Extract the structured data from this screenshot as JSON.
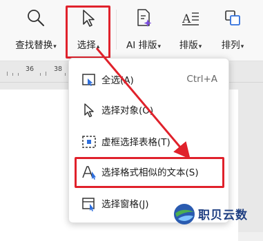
{
  "toolbar": {
    "find_replace_label": "查找替换",
    "select_label": "选择",
    "ai_layout_label": "AI 排版",
    "layout_label": "排版",
    "arrange_label": "排列"
  },
  "ruler": {
    "labels": [
      "36",
      "38"
    ]
  },
  "menu": {
    "items": [
      {
        "label": "全选(A)",
        "shortcut": "Ctrl+A",
        "icon": "select-all-icon"
      },
      {
        "label": "选择对象(O)",
        "icon": "cursor-arrow-icon"
      },
      {
        "label": "虚框选择表格(T)",
        "icon": "dashed-frame-icon"
      },
      {
        "label": "选择格式相似的文本(S)",
        "icon": "text-cursor-icon"
      },
      {
        "label": "选择窗格(J)",
        "icon": "pane-icon"
      }
    ]
  },
  "watermark": {
    "text": "职贝云数"
  },
  "colors": {
    "highlight": "#e0212b",
    "accent": "#2f6fdc",
    "ai_purple": "#7b4dde"
  }
}
